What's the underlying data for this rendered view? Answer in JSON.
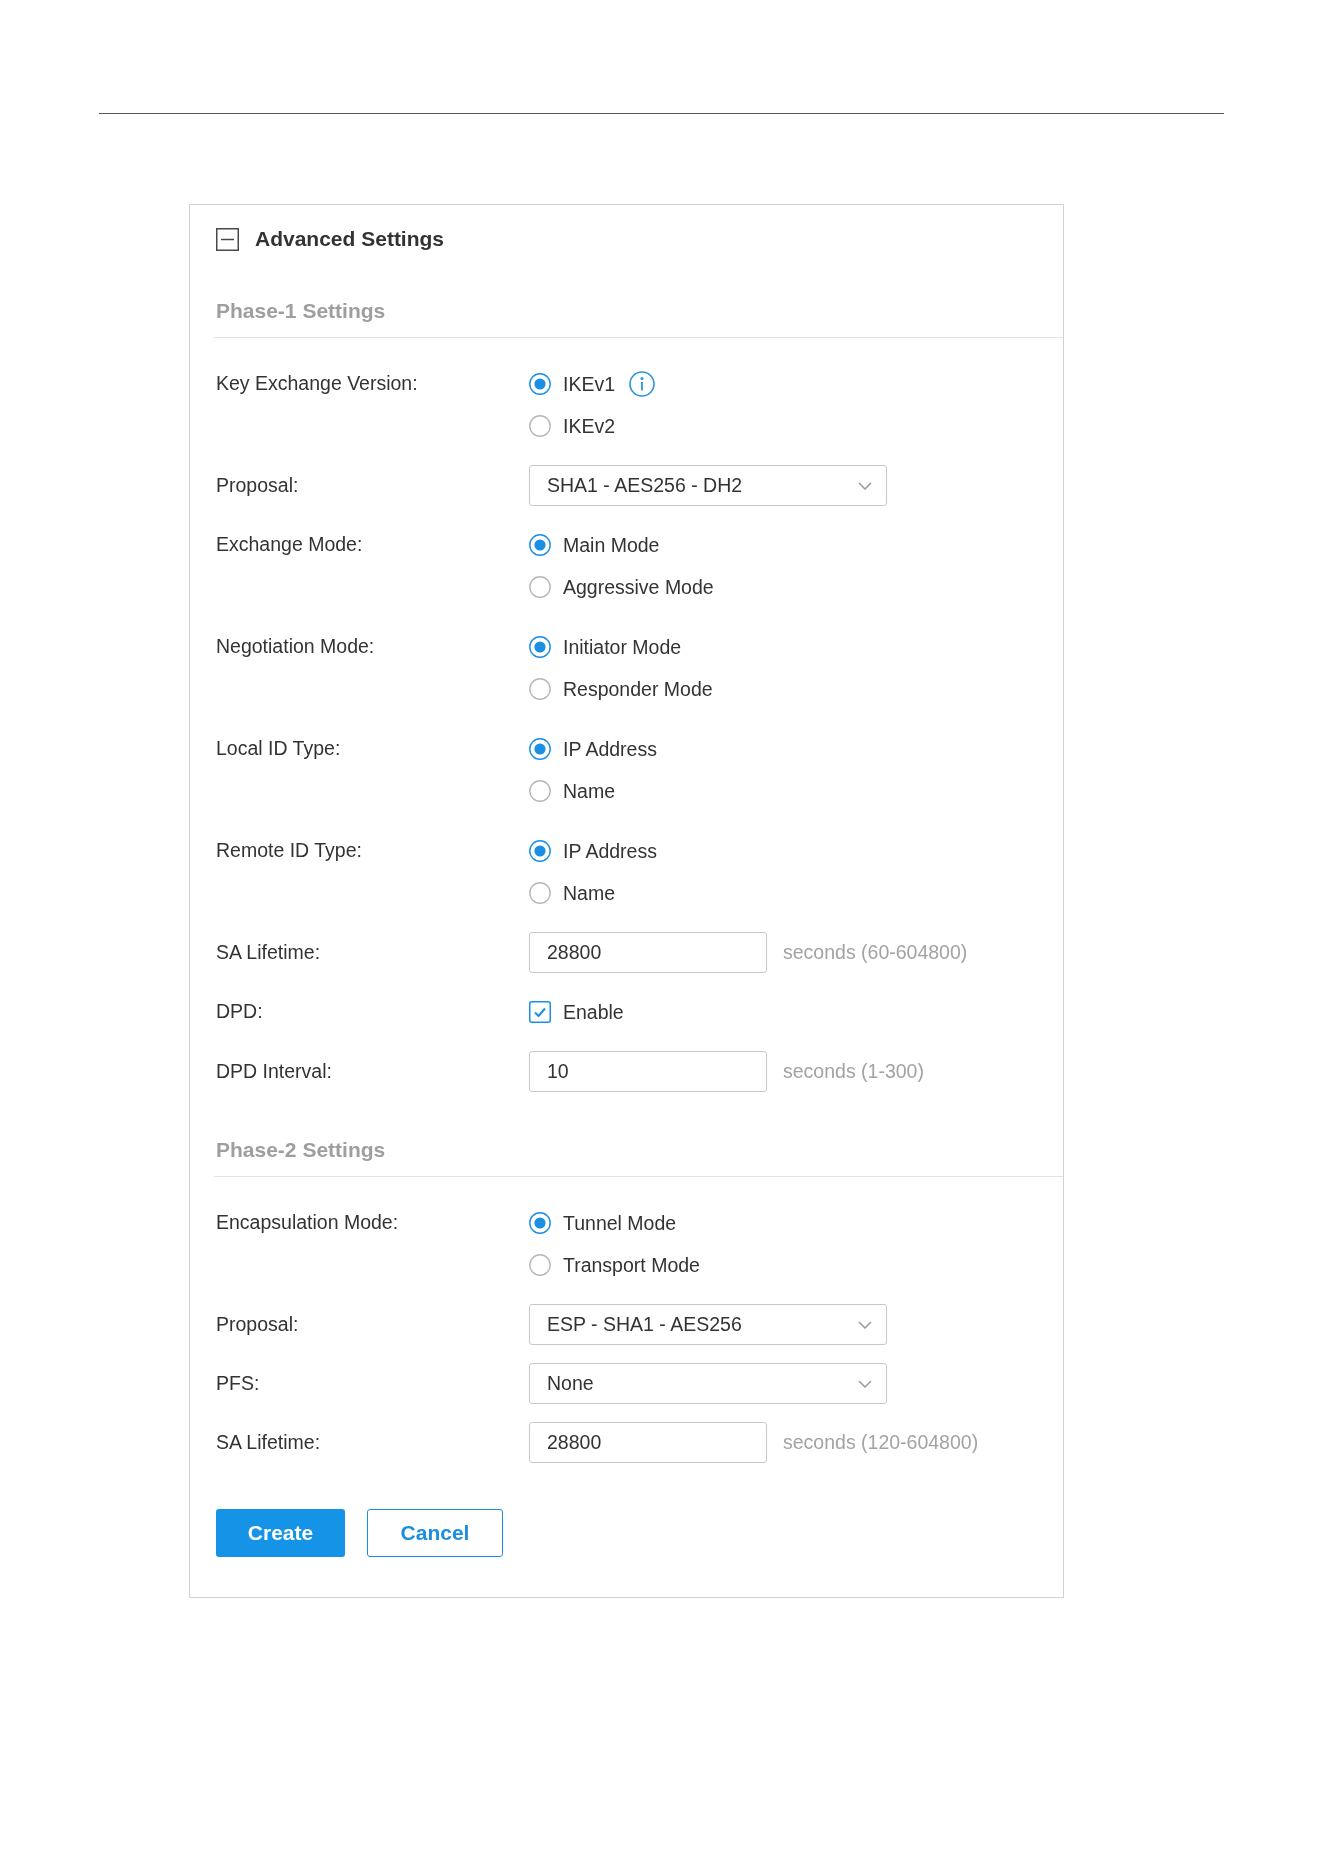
{
  "panel": {
    "title": "Advanced Settings",
    "expanded": true
  },
  "sections": [
    {
      "title": "Phase-1 Settings",
      "fields": [
        {
          "kind": "radio",
          "label": "Key Exchange Version:",
          "options": [
            {
              "label": "IKEv1",
              "selected": true,
              "info": true
            },
            {
              "label": "IKEv2",
              "selected": false,
              "info": false
            }
          ]
        },
        {
          "kind": "select",
          "label": "Proposal:",
          "value": "SHA1 - AES256 - DH2"
        },
        {
          "kind": "radio",
          "label": "Exchange Mode:",
          "options": [
            {
              "label": "Main Mode",
              "selected": true,
              "info": false
            },
            {
              "label": "Aggressive Mode",
              "selected": false,
              "info": false
            }
          ]
        },
        {
          "kind": "radio",
          "label": "Negotiation Mode:",
          "options": [
            {
              "label": "Initiator Mode",
              "selected": true,
              "info": false
            },
            {
              "label": "Responder Mode",
              "selected": false,
              "info": false
            }
          ]
        },
        {
          "kind": "radio",
          "label": "Local ID Type:",
          "options": [
            {
              "label": "IP Address",
              "selected": true,
              "info": false
            },
            {
              "label": "Name",
              "selected": false,
              "info": false
            }
          ]
        },
        {
          "kind": "radio",
          "label": "Remote ID Type:",
          "options": [
            {
              "label": "IP Address",
              "selected": true,
              "info": false
            },
            {
              "label": "Name",
              "selected": false,
              "info": false
            }
          ]
        },
        {
          "kind": "input",
          "label": "SA Lifetime:",
          "value": "28800",
          "hint": "seconds (60-604800)"
        },
        {
          "kind": "checkbox",
          "label": "DPD:",
          "text": "Enable",
          "checked": true
        },
        {
          "kind": "input",
          "label": "DPD Interval:",
          "value": "10",
          "hint": "seconds (1-300)"
        }
      ]
    },
    {
      "title": "Phase-2 Settings",
      "fields": [
        {
          "kind": "radio",
          "label": "Encapsulation Mode:",
          "options": [
            {
              "label": "Tunnel Mode",
              "selected": true,
              "info": false
            },
            {
              "label": "Transport Mode",
              "selected": false,
              "info": false
            }
          ]
        },
        {
          "kind": "select",
          "label": "Proposal:",
          "value": "ESP - SHA1 - AES256"
        },
        {
          "kind": "select",
          "label": "PFS:",
          "value": "None"
        },
        {
          "kind": "input",
          "label": "SA Lifetime:",
          "value": "28800",
          "hint": "seconds (120-604800)"
        }
      ]
    }
  ],
  "buttons": [
    {
      "label": "Create",
      "kind": "primary"
    },
    {
      "label": "Cancel",
      "kind": "secondary"
    }
  ]
}
